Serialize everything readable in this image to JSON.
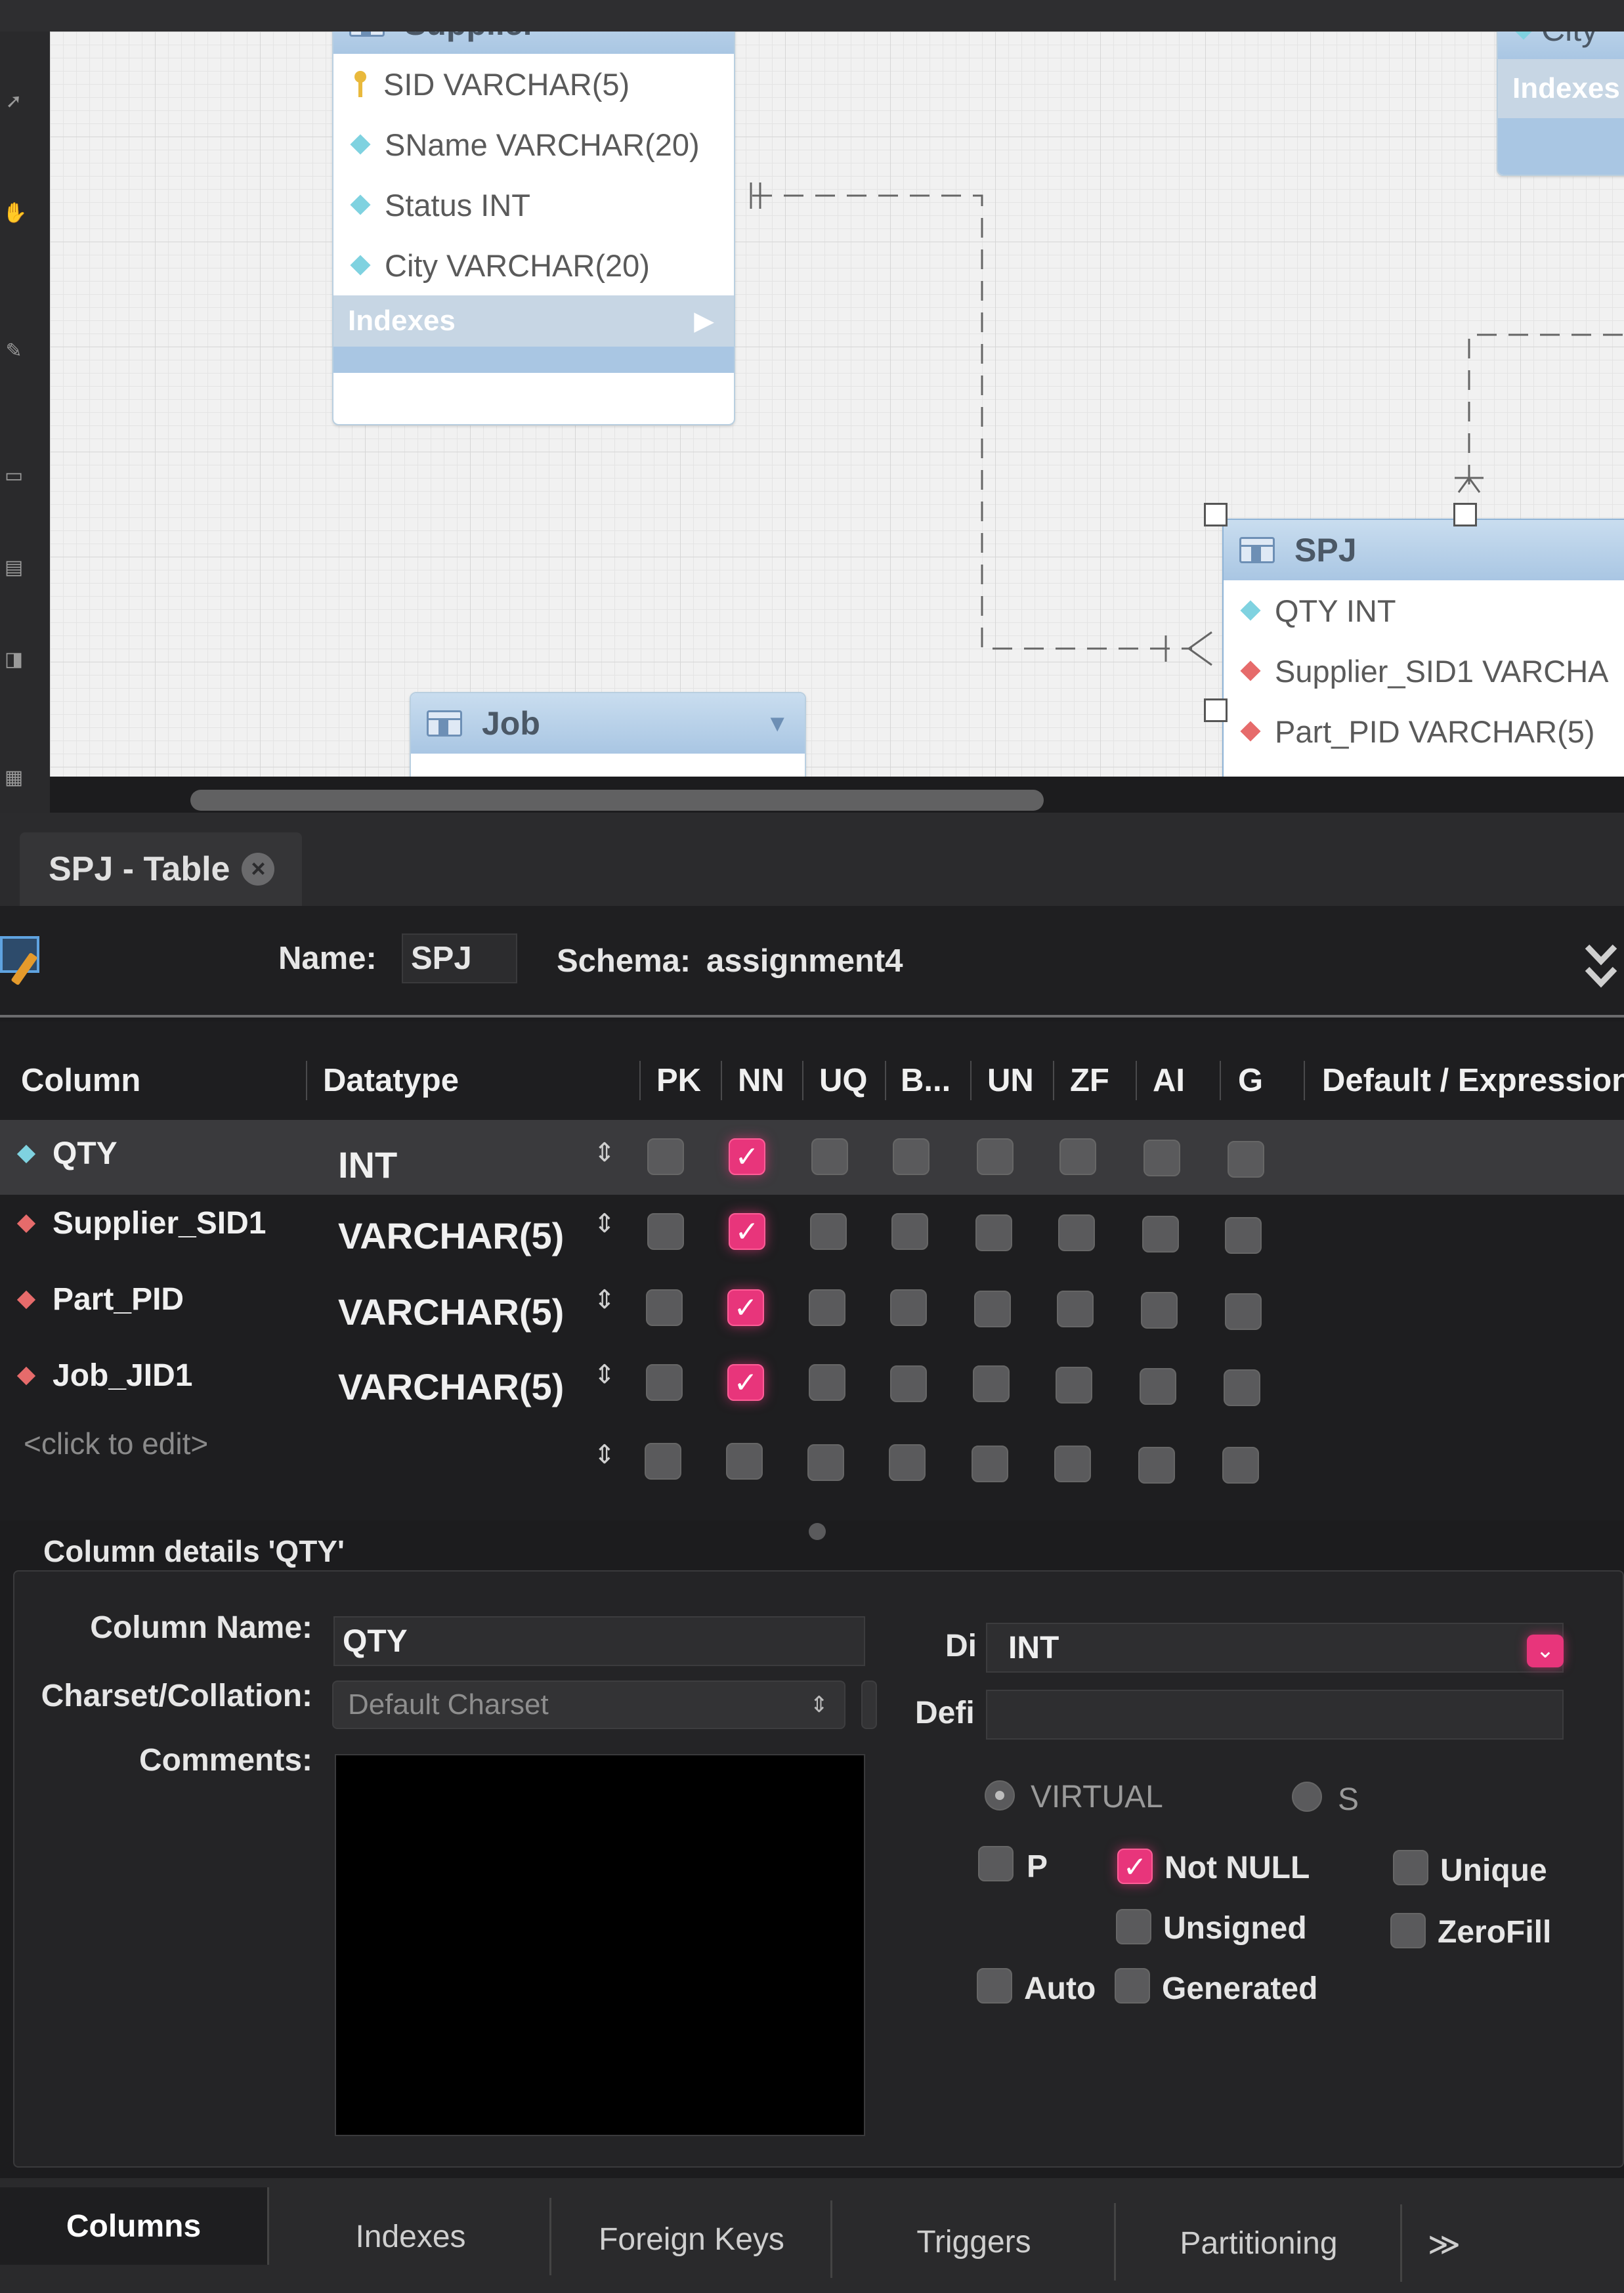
{
  "er_diagram": {
    "entities": {
      "supplier": {
        "title": "Supplier",
        "columns": [
          {
            "label": "SID VARCHAR(5)",
            "icon": "primary-key-icon"
          },
          {
            "label": "SName VARCHAR(20)",
            "icon": "column-diamond-icon"
          },
          {
            "label": "Status INT",
            "icon": "column-diamond-icon"
          },
          {
            "label": "City VARCHAR(20)",
            "icon": "column-diamond-icon"
          }
        ],
        "indexes_label": "Indexes"
      },
      "city": {
        "title": "City",
        "indexes_label": "Indexes"
      },
      "spj": {
        "title": "SPJ",
        "columns": [
          {
            "label": "QTY INT",
            "icon": "column-diamond-icon"
          },
          {
            "label": "Supplier_SID1 VARCHA",
            "icon": "foreign-key-diamond-icon"
          },
          {
            "label": "Part_PID VARCHAR(5)",
            "icon": "foreign-key-diamond-icon"
          }
        ]
      },
      "job": {
        "title": "Job"
      }
    },
    "colors": {
      "canvas": "#f1f1f1",
      "entity_header": "#a9c6e3",
      "fk_marker": "#e66b6b",
      "column_marker": "#7fd2e0"
    }
  },
  "editor_tab": {
    "label": "SPJ - Table"
  },
  "table_header": {
    "name_label": "Name:",
    "name_value": "SPJ",
    "schema_label": "Schema:",
    "schema_value": "assignment4"
  },
  "columns_grid": {
    "headers": {
      "column": "Column",
      "datatype": "Datatype",
      "pk": "PK",
      "nn": "NN",
      "uq": "UQ",
      "b": "B...",
      "un": "UN",
      "zf": "ZF",
      "ai": "AI",
      "g": "G",
      "default": "Default / Expression"
    },
    "rows": [
      {
        "name": "QTY",
        "datatype": "INT",
        "key": "column",
        "pk": false,
        "nn": true,
        "uq": false,
        "b": false,
        "un": false,
        "zf": false,
        "ai": false,
        "g": false,
        "selected": true
      },
      {
        "name": "Supplier_SID1",
        "datatype": "VARCHAR(5)",
        "key": "foreign-key",
        "pk": false,
        "nn": true,
        "uq": false,
        "b": false,
        "un": false,
        "zf": false,
        "ai": false,
        "g": false
      },
      {
        "name": "Part_PID",
        "datatype": "VARCHAR(5)",
        "key": "foreign-key",
        "pk": false,
        "nn": true,
        "uq": false,
        "b": false,
        "un": false,
        "zf": false,
        "ai": false,
        "g": false
      },
      {
        "name": "Job_JID1",
        "datatype": "VARCHAR(5)",
        "key": "foreign-key",
        "pk": false,
        "nn": true,
        "uq": false,
        "b": false,
        "un": false,
        "zf": false,
        "ai": false,
        "g": false
      }
    ],
    "new_row_placeholder": "<click to edit>"
  },
  "column_details": {
    "title": "Column details 'QTY'",
    "column_name_label": "Column Name:",
    "column_name_value": "QTY",
    "charset_label": "Charset/Collation:",
    "charset_value": "Default Charset",
    "comments_label": "Comments:",
    "datatype_label": "Di",
    "datatype_value": "INT",
    "default_label": "Defi",
    "default_value": "",
    "virtual_label": "VIRTUAL",
    "stored_label": "S",
    "options": {
      "primary_key": {
        "label": "P",
        "checked": false
      },
      "not_null": {
        "label": "Not NULL",
        "checked": true
      },
      "unique": {
        "label": "Unique",
        "checked": false
      },
      "unsigned": {
        "label": "Unsigned",
        "checked": false
      },
      "zerofill": {
        "label": "ZeroFill",
        "checked": false
      },
      "auto_increment": {
        "label": "Auto",
        "checked": false
      },
      "generated": {
        "label": "Generated",
        "checked": false
      }
    },
    "accent_color": "#e8357b"
  },
  "bottom_tabs": [
    {
      "label": "Columns",
      "active": true
    },
    {
      "label": "Indexes"
    },
    {
      "label": "Foreign Keys"
    },
    {
      "label": "Triggers"
    },
    {
      "label": "Partitioning"
    },
    {
      "label": "≫"
    }
  ]
}
